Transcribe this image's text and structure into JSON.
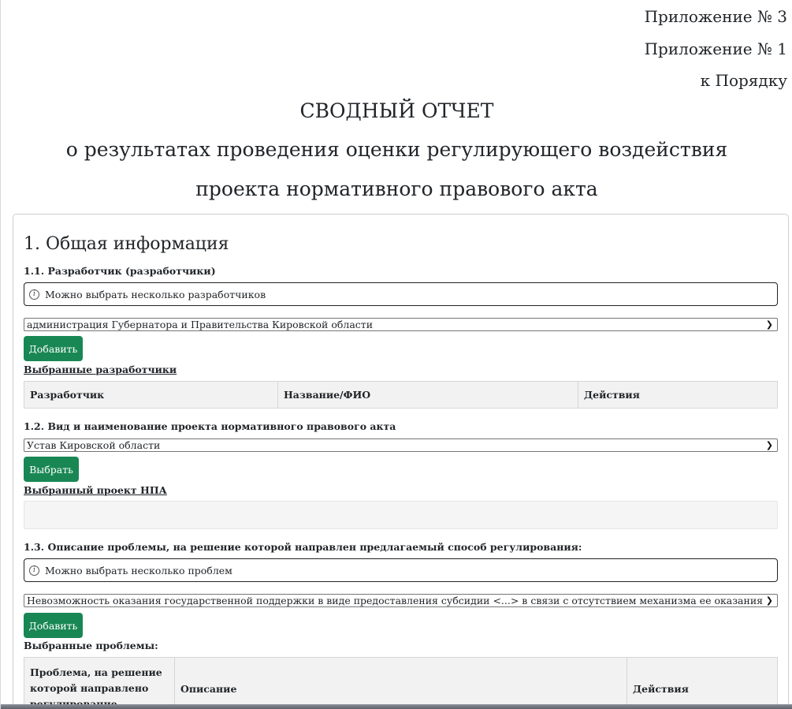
{
  "header": {
    "appendix_1": "Приложение № 3",
    "appendix_2": "Приложение № 1",
    "appendix_3": "к Порядку",
    "title_1": "СВОДНЫЙ ОТЧЕТ",
    "title_2": "о результатах проведения оценки регулирующего воздействия",
    "title_3": "проекта нормативного правового акта"
  },
  "section1": {
    "title": "1. Общая информация",
    "developer": {
      "label": "1.1. Разработчик (разработчики)",
      "info": "Можно выбрать несколько разработчиков",
      "selected_value": "администрация Губернатора и Правительства Кировской области",
      "add_button": "Добавить",
      "selected_label": "Выбранные разработчики",
      "columns": [
        "Разработчик",
        "Название/ФИО",
        "Действия"
      ]
    },
    "npa": {
      "label": "1.2. Вид и наименование проекта нормативного правового акта",
      "selected_value": "Устав Кировской области",
      "choose_button": "Выбрать",
      "selected_label": "Выбранный проект НПА"
    },
    "problems": {
      "label": "1.3. Описание проблемы, на решение которой направлен предлагаемый способ регулирования:",
      "info": "Можно выбрать несколько проблем",
      "selected_value": "Невозможность оказания государственной поддержки в виде предоставления субсидии <...> в связи с отсутствием механизма ее оказания",
      "add_button": "Добавить",
      "selected_label": "Выбранные проблемы:",
      "columns": [
        "Проблема, на решение которой направлено регулирование",
        "Описание",
        "Действия"
      ]
    }
  },
  "icons": {
    "info": "info-icon",
    "dropdown": "chevron-down-icon"
  },
  "colors": {
    "button": "#198754"
  }
}
